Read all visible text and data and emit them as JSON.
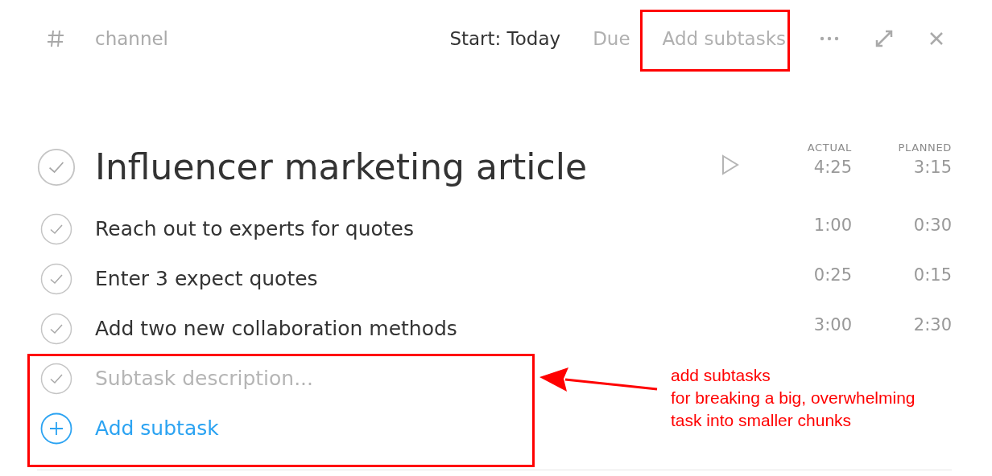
{
  "header": {
    "channel": "channel",
    "start": "Start: Today",
    "due": "Due",
    "add_subtasks": "Add subtasks"
  },
  "task": {
    "title": "Influencer marketing article",
    "checked": false,
    "columns": [
      "ACTUAL",
      "PLANNED"
    ],
    "actual": "4:25",
    "planned": "3:15"
  },
  "subtasks": [
    {
      "label": "Reach out to experts for quotes",
      "checked": false,
      "actual": "1:00",
      "planned": "0:30"
    },
    {
      "label": "Enter 3 expect quotes",
      "checked": false,
      "actual": "0:25",
      "planned": "0:15"
    },
    {
      "label": "Add two new collaboration methods",
      "checked": false,
      "actual": "3:00",
      "planned": "2:30"
    }
  ],
  "new_subtask": {
    "placeholder": "Subtask description..."
  },
  "add_subtask": "Add subtask",
  "annotation": {
    "lines": [
      "add subtasks",
      "for breaking a big, overwhelming",
      "task into smaller chunks"
    ]
  }
}
